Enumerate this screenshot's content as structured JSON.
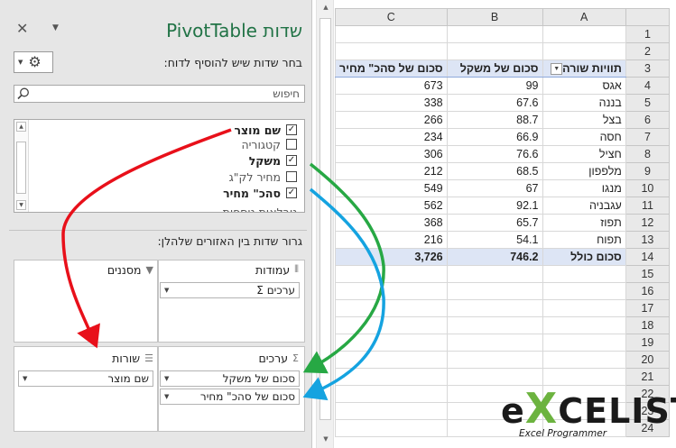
{
  "pane": {
    "title": "שדות PivotTable",
    "close_glyph": "✕",
    "menu_glyph": "▼",
    "subtitle": "בחר שדות שיש להוסיף לדוח:",
    "search_placeholder": "חיפוש",
    "fields": [
      {
        "label": "שם מוצר",
        "checked": true
      },
      {
        "label": "קטגוריה",
        "checked": false
      },
      {
        "label": "משקל",
        "checked": true
      },
      {
        "label": "מחיר לק\"ג",
        "checked": false
      },
      {
        "label": "סהכ\" מחיר",
        "checked": true
      },
      {
        "label": "טבלאות נוספות",
        "checked": false
      }
    ],
    "drag_instruction": "גרור שדות בין האזורים שלהלן:",
    "areas": {
      "filters": {
        "label": "מסננים",
        "items": []
      },
      "columns": {
        "label": "עמודות",
        "items": [
          "ערכים"
        ]
      },
      "rows": {
        "label": "שורות",
        "items": [
          "שם מוצר"
        ]
      },
      "values": {
        "label": "ערכים",
        "items": [
          "סכום של משקל",
          "סכום של סהכ\" מחיר"
        ]
      }
    }
  },
  "sheet": {
    "columns": [
      "A",
      "B",
      "C"
    ],
    "row_numbers": [
      "1",
      "2",
      "3",
      "4",
      "5",
      "6",
      "7",
      "8",
      "9",
      "10",
      "11",
      "12",
      "13",
      "14",
      "15",
      "16",
      "17",
      "18",
      "19",
      "20",
      "21",
      "22",
      "23",
      "24"
    ],
    "pivot": {
      "headers": {
        "a": "תוויות שורה",
        "b": "סכום של משקל",
        "c": "סכום של סהכ\" מחיר"
      },
      "rows": [
        {
          "name": "אגס",
          "weight": "99",
          "price": "673"
        },
        {
          "name": "בננה",
          "weight": "67.6",
          "price": "338"
        },
        {
          "name": "בצל",
          "weight": "88.7",
          "price": "266"
        },
        {
          "name": "חסה",
          "weight": "66.9",
          "price": "234"
        },
        {
          "name": "חציל",
          "weight": "76.6",
          "price": "306"
        },
        {
          "name": "מלפפון",
          "weight": "68.5",
          "price": "212"
        },
        {
          "name": "מנגו",
          "weight": "67",
          "price": "549"
        },
        {
          "name": "עגבניה",
          "weight": "92.1",
          "price": "562"
        },
        {
          "name": "תפוז",
          "weight": "65.7",
          "price": "368"
        },
        {
          "name": "תפוח",
          "weight": "54.1",
          "price": "216"
        }
      ],
      "total": {
        "name": "סכום כולל",
        "weight": "746.2",
        "price": "3,726"
      }
    }
  },
  "logo": {
    "word_prefix": "e",
    "word_x": "X",
    "word_suffix": "CELIST",
    "tagline": "Excel Programmer"
  },
  "colors": {
    "arrow_red": "#e8101a",
    "arrow_green": "#27a844",
    "arrow_blue": "#15a3e0",
    "brand_green": "#217346",
    "logo_x": "#6cb33f",
    "pivot_header": "#dde5f5"
  }
}
